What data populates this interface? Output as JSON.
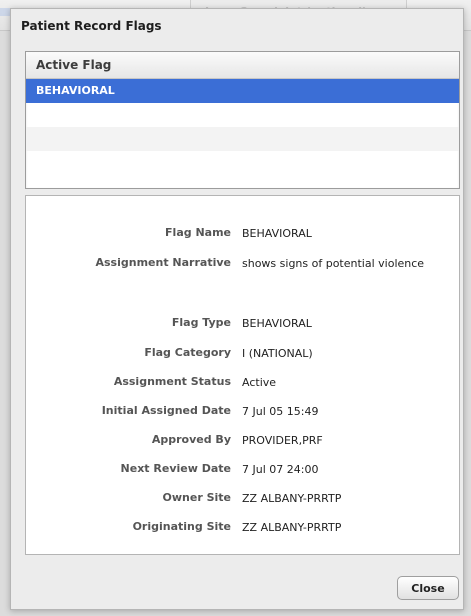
{
  "background": {
    "tab_label": "Long Complaint (optional)"
  },
  "dialog": {
    "title": "Patient Record Flags",
    "flag_list": {
      "column_header": "Active Flag",
      "rows": [
        {
          "label": "BEHAVIORAL",
          "selected": true
        },
        {
          "label": "",
          "selected": false
        },
        {
          "label": "",
          "selected": false
        },
        {
          "label": "",
          "selected": false
        }
      ]
    },
    "details": [
      {
        "label": "Flag Name",
        "value": "BEHAVIORAL"
      },
      {
        "label": "Assignment Narrative",
        "value": "shows signs of potential violence"
      },
      {
        "label": "Flag Type",
        "value": "BEHAVIORAL"
      },
      {
        "label": "Flag Category",
        "value": "I (NATIONAL)"
      },
      {
        "label": "Assignment Status",
        "value": "Active"
      },
      {
        "label": "Initial Assigned Date",
        "value": "7 Jul 05 15:49"
      },
      {
        "label": "Approved By",
        "value": "PROVIDER,PRF"
      },
      {
        "label": "Next Review Date",
        "value": "7 Jul 07 24:00"
      },
      {
        "label": "Owner Site",
        "value": "ZZ ALBANY-PRRTP"
      },
      {
        "label": "Originating Site",
        "value": "ZZ ALBANY-PRRTP"
      }
    ],
    "close_label": "Close"
  },
  "colors": {
    "selection": "#3b6ed6",
    "dialog_bg": "#ececec",
    "panel_bg": "#ffffff"
  }
}
